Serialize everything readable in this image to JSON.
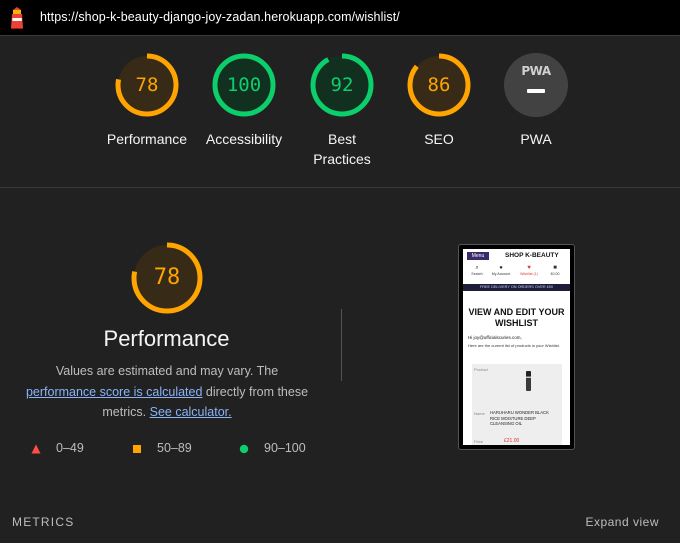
{
  "header": {
    "url": "https://shop-k-beauty-django-joy-zadan.herokuapp.com/wishlist/"
  },
  "colors": {
    "average": "#ffa400",
    "pass": "#0cce6b",
    "fail": "#ff4e42",
    "pwa": "#9e9e9e"
  },
  "scores": [
    {
      "label": "Performance",
      "value": "78",
      "fraction": 0.78,
      "color": "#ffa400"
    },
    {
      "label": "Accessibility",
      "value": "100",
      "fraction": 1.0,
      "color": "#0cce6b"
    },
    {
      "label": "Best Practices",
      "value": "92",
      "fraction": 0.92,
      "color": "#0cce6b"
    },
    {
      "label": "SEO",
      "value": "86",
      "fraction": 0.86,
      "color": "#ffa400"
    },
    {
      "label": "PWA",
      "badge": "PWA"
    }
  ],
  "performance": {
    "value": "78",
    "fraction": 0.78,
    "title": "Performance",
    "desc_pre": "Values are estimated and may vary. The ",
    "desc_link1": "performance score is calculated",
    "desc_mid": " directly from these metrics. ",
    "desc_link2": "See calculator.",
    "legend": [
      {
        "range": "0–49",
        "icon": "triangle-icon"
      },
      {
        "range": "50–89",
        "icon": "square-icon"
      },
      {
        "range": "90–100",
        "icon": "circle-icon"
      }
    ]
  },
  "screenshot": {
    "menu": "Menu",
    "brand": "SHOP K-BEAUTY",
    "nav": [
      {
        "label": "Search",
        "icon": "search-icon"
      },
      {
        "label": "My Account",
        "icon": "user-icon"
      },
      {
        "label": "Wishlist (1)",
        "icon": "heart-icon"
      },
      {
        "label": "£0.00",
        "icon": "bag-icon"
      }
    ],
    "banner": "FREE DELIVERY ON ORDERS OVER £50",
    "heading": "VIEW AND EDIT YOUR WISHLIST",
    "greeting": "Hi joy@ufficialscuries.com,",
    "sub": "Here are the current list of products in your Wishlist.",
    "product_label": "Product",
    "name_label": "Name",
    "product_name": "HARUHARU WONDER BLACK RICE MOISTURE DEEP CLEANSING OIL",
    "price_label": "Price",
    "price": "£21.00"
  },
  "footer": {
    "metrics": "METRICS",
    "expand": "Expand view"
  }
}
